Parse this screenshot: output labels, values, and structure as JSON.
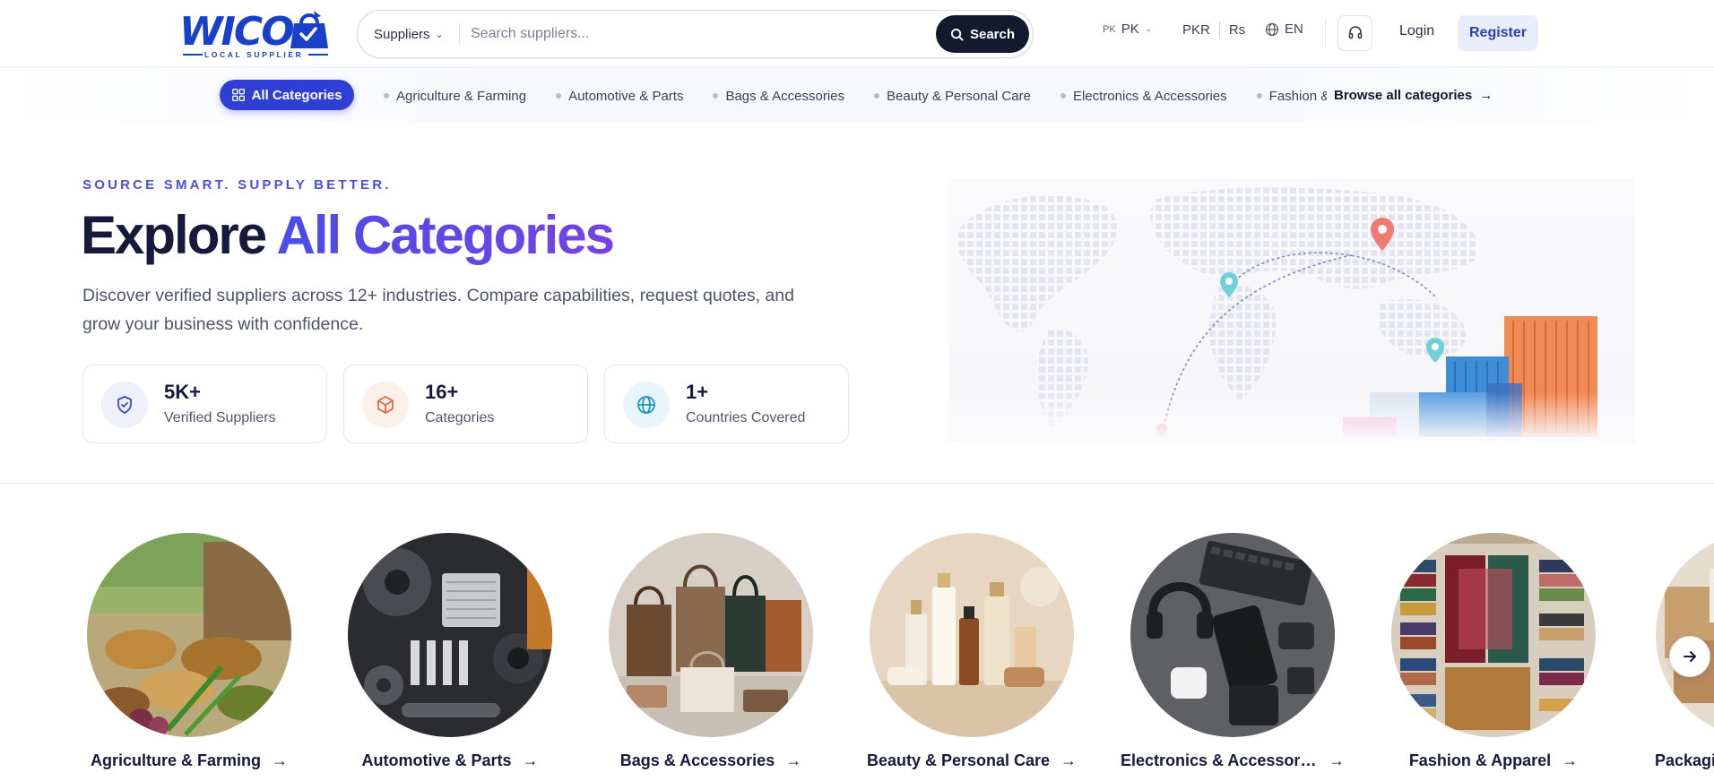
{
  "header": {
    "logo_text": "WICO",
    "logo_tagline": "LOCAL SUPPLIER",
    "search": {
      "category": "Suppliers",
      "placeholder": "Search suppliers...",
      "button_label": "Search"
    },
    "country": {
      "flag": "PK",
      "code": "PK"
    },
    "currency": {
      "code": "PKR",
      "symbol": "Rs"
    },
    "language": "EN",
    "login_label": "Login",
    "register_label": "Register"
  },
  "category_nav": {
    "all_label": "All Categories",
    "items": [
      "Agriculture & Farming",
      "Automotive & Parts",
      "Bags & Accessories",
      "Beauty & Personal Care",
      "Electronics & Accessories",
      "Fashion & Apparel"
    ],
    "browse_all_label": "Browse all categories"
  },
  "hero": {
    "eyebrow": "SOURCE SMART. SUPPLY BETTER.",
    "title_plain": "Explore",
    "title_accent": "All Categories",
    "subtitle": "Discover verified suppliers across 12+ industries. Compare capabilities, request quotes, and grow your business with confidence.",
    "stats": [
      {
        "value": "5K+",
        "label": "Verified Suppliers",
        "icon": "shield-check-icon"
      },
      {
        "value": "16+",
        "label": "Categories",
        "icon": "box-icon"
      },
      {
        "value": "1+",
        "label": "Countries Covered",
        "icon": "globe-icon"
      }
    ]
  },
  "categories": [
    {
      "label": "Agriculture & Farming"
    },
    {
      "label": "Automotive & Parts"
    },
    {
      "label": "Bags & Accessories"
    },
    {
      "label": "Beauty & Personal Care"
    },
    {
      "label": "Electronics & Accessories"
    },
    {
      "label": "Fashion & Apparel"
    },
    {
      "label": "Packaging"
    }
  ],
  "colors": {
    "brand": "#1a3fc8",
    "accent": "#4a4fe0",
    "dark": "#131a2e",
    "text": "#161a3a"
  }
}
